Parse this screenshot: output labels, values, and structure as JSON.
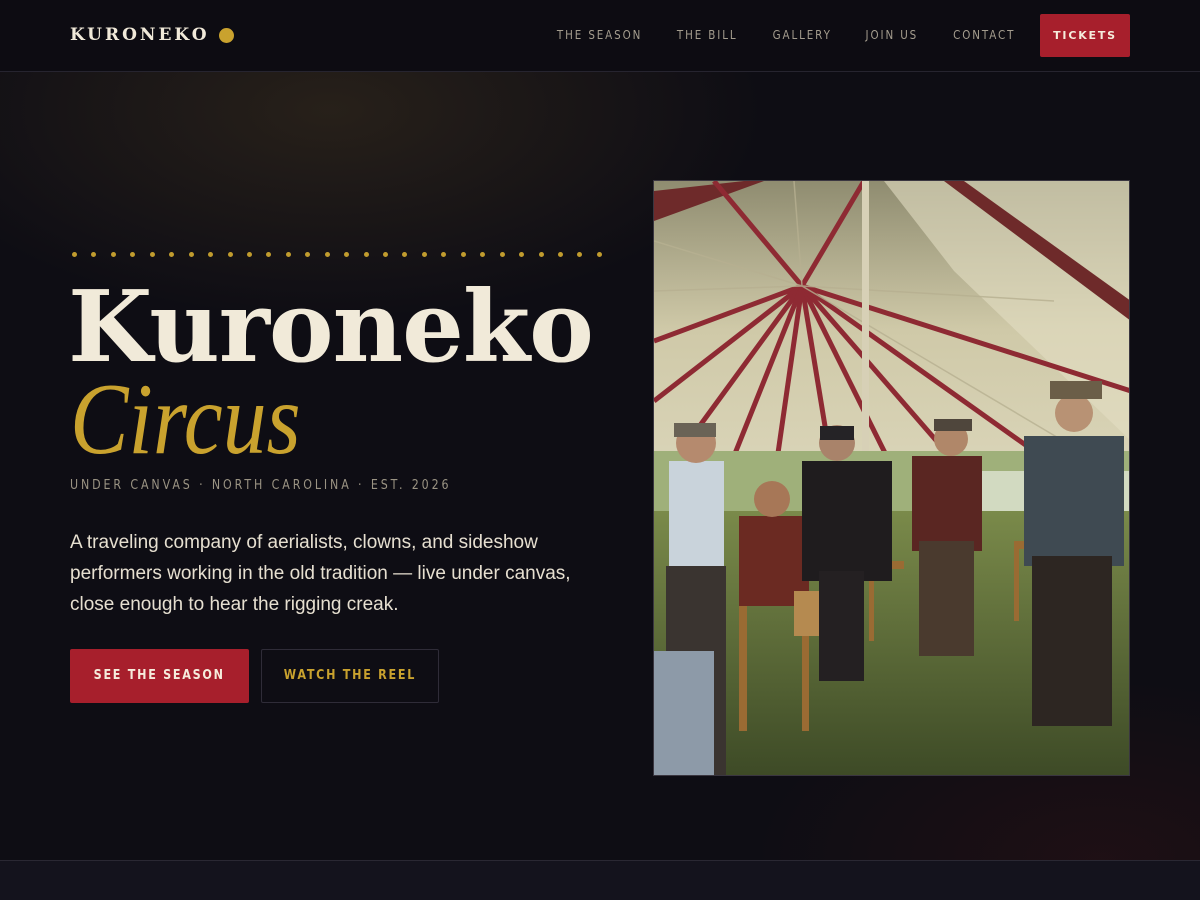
{
  "header": {
    "logo_text": "KURONEKO",
    "nav": [
      "THE SEASON",
      "THE BILL",
      "GALLERY",
      "JOIN US",
      "CONTACT"
    ],
    "tickets_label": "TICKETS"
  },
  "hero": {
    "title_main": "Kuroneko",
    "title_sub": "Circus",
    "tagline": "UNDER CANVAS · NORTH CAROLINA · EST. 2026",
    "description": "A traveling company of aerialists, clowns, and sideshow performers working in the old tradition — live under canvas, close enough to hear the rigging creak.",
    "primary_button": "SEE THE SEASON",
    "secondary_button": "WATCH THE REEL"
  },
  "colors": {
    "background": "#0e0d14",
    "accent_gold": "#c9a22e",
    "accent_red": "#a71f2c",
    "cream": "#f1ead9"
  }
}
